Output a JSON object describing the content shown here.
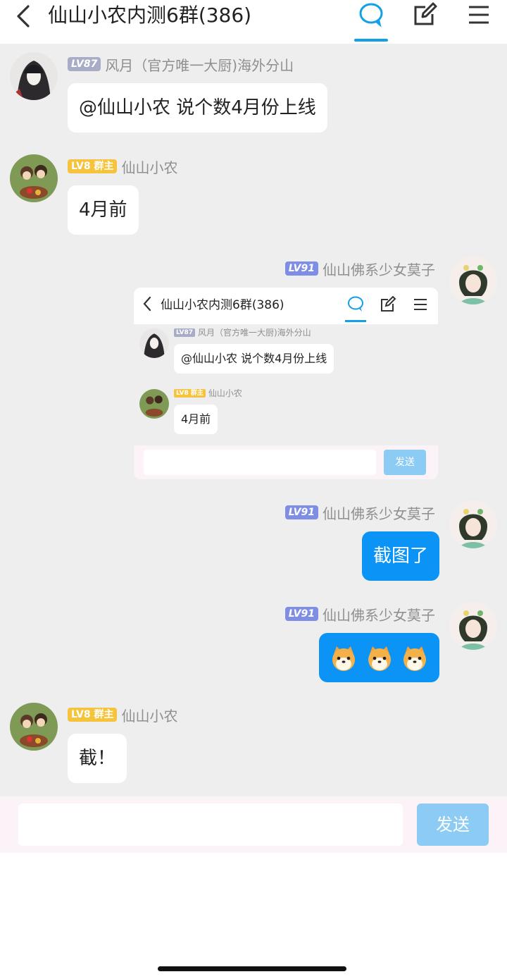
{
  "header": {
    "title": "仙山小农内测6群(386)",
    "icons": [
      "back-arrow-icon",
      "chat-bubble-icon",
      "edit-icon",
      "menu-icon"
    ],
    "accent_color": "#12a0e6"
  },
  "messages": [
    {
      "side": "left",
      "level": "LV87",
      "badge": "",
      "sender": "风月（官方唯一大厨)海外分山",
      "text": "@仙山小农 说个数4月份上线"
    },
    {
      "side": "left",
      "level": "LV8",
      "badge": "群主",
      "sender": "仙山小农",
      "text": "4月前"
    },
    {
      "side": "right",
      "level": "LV91",
      "badge": "",
      "sender": "仙山佛系少女莫子",
      "type": "image"
    },
    {
      "side": "right",
      "level": "LV91",
      "badge": "",
      "sender": "仙山佛系少女莫子",
      "text": "截图了"
    },
    {
      "side": "right",
      "level": "LV91",
      "badge": "",
      "sender": "仙山佛系少女莫子",
      "type": "emoji",
      "emoji_count": 3,
      "emoji_icon": "shiba-dog-emoji-icon"
    },
    {
      "side": "left",
      "level": "LV8",
      "badge": "群主",
      "sender": "仙山小农",
      "text": "截！"
    }
  ],
  "screenshot": {
    "title": "仙山小农内测6群(386)",
    "messages": [
      {
        "level": "LV87",
        "badge": "",
        "sender": "风月（官方唯一大厨)海外分山",
        "text": "@仙山小农 说个数4月份上线"
      },
      {
        "level": "LV8",
        "badge": "群主",
        "sender": "仙山小农",
        "text": "4月前"
      }
    ],
    "send_label": "发送"
  },
  "composer": {
    "placeholder": "",
    "send_label": "发送",
    "send_color": "#8ccbf3"
  },
  "colors": {
    "chat_bg": "#eeeeef",
    "outgoing_bubble": "#0b93f6",
    "incoming_bubble": "#ffffff",
    "owner_badge": "#f6c33c"
  }
}
